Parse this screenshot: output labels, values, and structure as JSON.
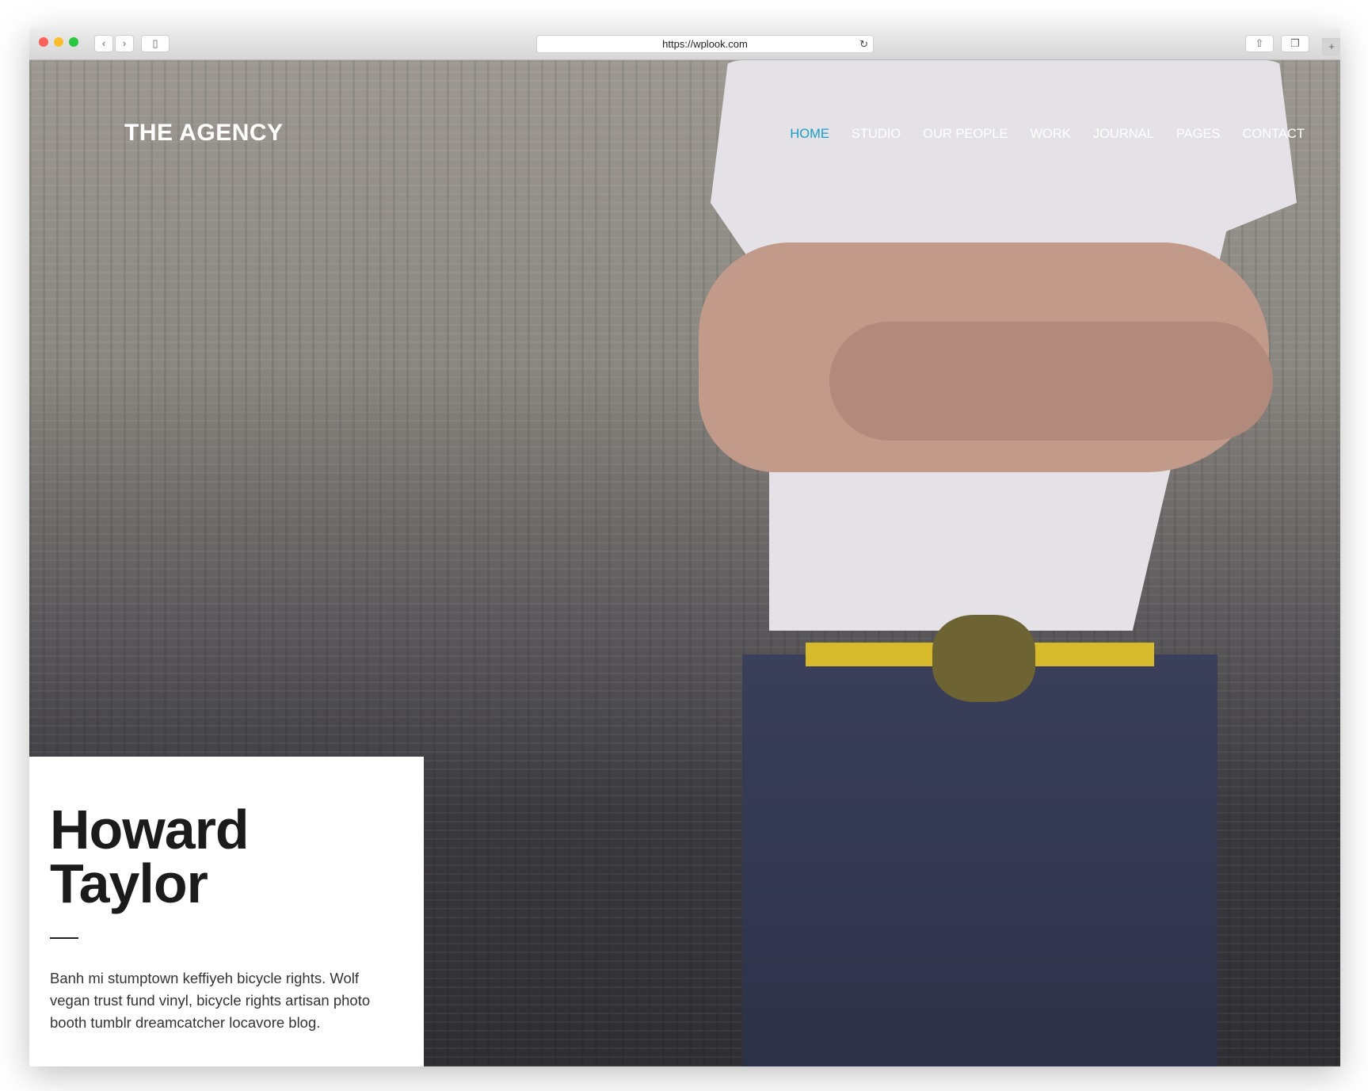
{
  "browser": {
    "url": "https://wplook.com",
    "back_icon": "chevron-left-icon",
    "forward_icon": "chevron-right-icon",
    "sidebar_icon": "sidebar-icon",
    "reload_icon": "reload-icon",
    "share_icon": "share-icon",
    "tabs_icon": "tabs-icon",
    "new_tab_icon": "plus-icon"
  },
  "site": {
    "logo": "THE AGENCY",
    "nav": [
      {
        "label": "HOME",
        "active": true
      },
      {
        "label": "STUDIO"
      },
      {
        "label": "OUR PEOPLE"
      },
      {
        "label": "WORK"
      },
      {
        "label": "JOURNAL"
      },
      {
        "label": "PAGES"
      },
      {
        "label": "CONTACT"
      }
    ],
    "accent": "#1a9cc4"
  },
  "hero": {
    "name_line1": "Howard",
    "name_line2": "Taylor",
    "bio": "Banh mi stumptown keffiyeh bicycle rights. Wolf vegan trust fund vinyl, bicycle rights artisan photo booth tumblr dreamcatcher locavore blog."
  }
}
